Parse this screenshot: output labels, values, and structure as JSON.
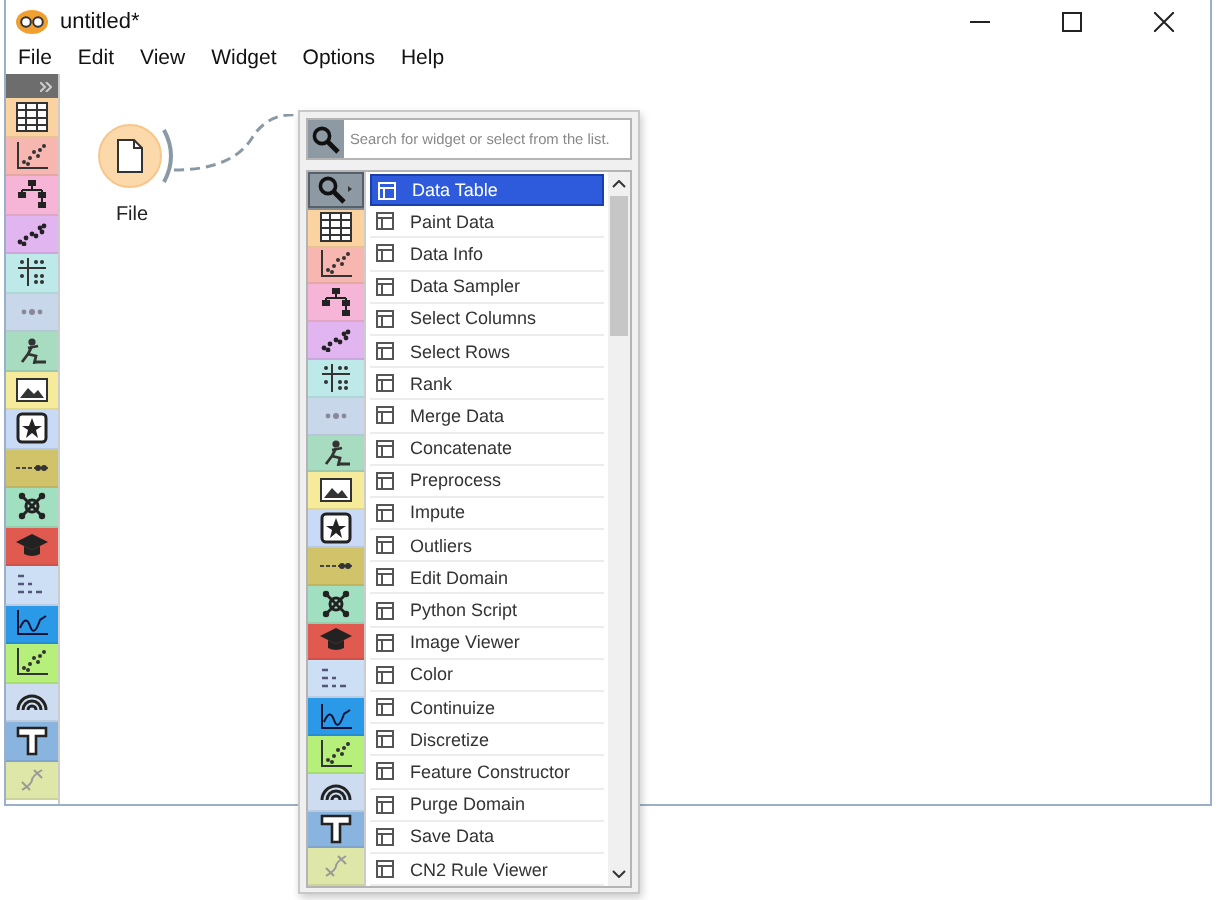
{
  "window": {
    "title": "untitled*"
  },
  "menu": [
    "File",
    "Edit",
    "View",
    "Widget",
    "Options",
    "Help"
  ],
  "toolbar": {
    "categories": [
      {
        "kind": "table",
        "color": "#fbd3a0"
      },
      {
        "kind": "scatter",
        "color": "#f7b7b0"
      },
      {
        "kind": "tree",
        "color": "#f6b5d6"
      },
      {
        "kind": "cluster",
        "color": "#e0b5f0"
      },
      {
        "kind": "grid",
        "color": "#bde9e9"
      },
      {
        "kind": "dots",
        "color": "#c8d8ea"
      },
      {
        "kind": "figure",
        "color": "#a8dcc0"
      },
      {
        "kind": "image",
        "color": "#f5eb9b"
      },
      {
        "kind": "star",
        "color": "#c8daf5"
      },
      {
        "kind": "linedots",
        "color": "#d1c36a"
      },
      {
        "kind": "network",
        "color": "#a0e0c0"
      },
      {
        "kind": "cap",
        "color": "#e05a4f"
      },
      {
        "kind": "text",
        "color": "#cddff5"
      },
      {
        "kind": "chart",
        "color": "#2a9ae8"
      },
      {
        "kind": "scatter",
        "color": "#b6f07a"
      },
      {
        "kind": "rainbow",
        "color": "#cddcf0"
      },
      {
        "kind": "tee",
        "color": "#8ab4e0"
      },
      {
        "kind": "dna",
        "color": "#dfe7a8"
      }
    ]
  },
  "node": {
    "label": "File"
  },
  "popup": {
    "search": {
      "placeholder": "Search for widget or select from the list."
    },
    "categories": [
      {
        "kind": "search",
        "color": "#8e9aa3",
        "selected": true
      },
      {
        "kind": "table",
        "color": "#fbd3a0",
        "selected": false
      },
      {
        "kind": "scatter",
        "color": "#f7b7b0",
        "selected": false
      },
      {
        "kind": "tree",
        "color": "#f6b5d6",
        "selected": false
      },
      {
        "kind": "cluster",
        "color": "#e0b5f0",
        "selected": false
      },
      {
        "kind": "grid",
        "color": "#bde9e9",
        "selected": false
      },
      {
        "kind": "dots",
        "color": "#c8d8ea",
        "selected": false
      },
      {
        "kind": "figure",
        "color": "#a8dcc0",
        "selected": false
      },
      {
        "kind": "image",
        "color": "#f5eb9b",
        "selected": false
      },
      {
        "kind": "star",
        "color": "#c8daf5",
        "selected": false
      },
      {
        "kind": "linedots",
        "color": "#d1c36a",
        "selected": false
      },
      {
        "kind": "network",
        "color": "#a0e0c0",
        "selected": false
      },
      {
        "kind": "cap",
        "color": "#e05a4f",
        "selected": false
      },
      {
        "kind": "text",
        "color": "#cddff5",
        "selected": false
      },
      {
        "kind": "chart",
        "color": "#2a9ae8",
        "selected": false
      },
      {
        "kind": "scatter",
        "color": "#b6f07a",
        "selected": false
      },
      {
        "kind": "rainbow",
        "color": "#cddcf0",
        "selected": false
      },
      {
        "kind": "tee",
        "color": "#8ab4e0",
        "selected": false
      },
      {
        "kind": "dna",
        "color": "#dfe7a8",
        "selected": false
      }
    ],
    "widgets": [
      {
        "label": "Data Table",
        "selected": true
      },
      {
        "label": "Paint Data",
        "selected": false
      },
      {
        "label": "Data Info",
        "selected": false
      },
      {
        "label": "Data Sampler",
        "selected": false
      },
      {
        "label": "Select Columns",
        "selected": false
      },
      {
        "label": "Select Rows",
        "selected": false
      },
      {
        "label": "Rank",
        "selected": false
      },
      {
        "label": "Merge Data",
        "selected": false
      },
      {
        "label": "Concatenate",
        "selected": false
      },
      {
        "label": "Preprocess",
        "selected": false
      },
      {
        "label": "Impute",
        "selected": false
      },
      {
        "label": "Outliers",
        "selected": false
      },
      {
        "label": "Edit Domain",
        "selected": false
      },
      {
        "label": "Python Script",
        "selected": false
      },
      {
        "label": "Image Viewer",
        "selected": false
      },
      {
        "label": "Color",
        "selected": false
      },
      {
        "label": "Continuize",
        "selected": false
      },
      {
        "label": "Discretize",
        "selected": false
      },
      {
        "label": "Feature Constructor",
        "selected": false
      },
      {
        "label": "Purge Domain",
        "selected": false
      },
      {
        "label": "Save Data",
        "selected": false
      },
      {
        "label": "CN2 Rule Viewer",
        "selected": false
      }
    ]
  }
}
